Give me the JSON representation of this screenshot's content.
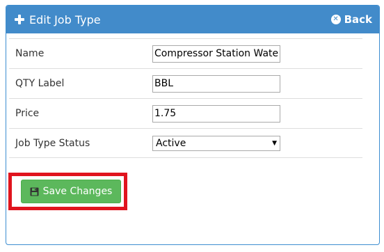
{
  "header": {
    "title": "Edit Job Type",
    "back_label": "Back"
  },
  "form": {
    "name": {
      "label": "Name",
      "value": "Compressor Station Wate"
    },
    "qty_label": {
      "label": "QTY Label",
      "value": "BBL"
    },
    "price": {
      "label": "Price",
      "value": "1.75"
    },
    "status": {
      "label": "Job Type Status",
      "selected": "Active"
    }
  },
  "actions": {
    "save_label": "Save Changes"
  },
  "icons": {
    "title_icon": "plus-icon",
    "back_icon": "back-circle-icon",
    "save_icon": "save-icon",
    "select_icon": "caret-down-icon"
  },
  "colors": {
    "header_bg": "#428bca",
    "save_bg": "#5cb85c",
    "highlight": "#e0141e"
  }
}
